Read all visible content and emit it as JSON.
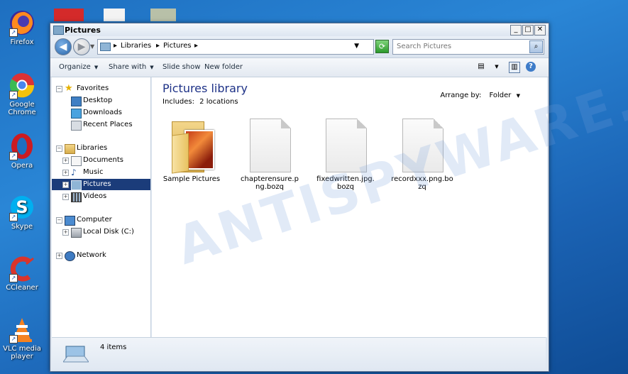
{
  "desktop": {
    "icons": [
      {
        "label": "Firefox",
        "icon": "firefox-icon"
      },
      {
        "label": "Google Chrome",
        "icon": "chrome-icon"
      },
      {
        "label": "Opera",
        "icon": "opera-icon"
      },
      {
        "label": "Skype",
        "icon": "skype-icon"
      },
      {
        "label": "CCleaner",
        "icon": "ccleaner-icon"
      },
      {
        "label": "VLC media player",
        "icon": "vlc-icon"
      }
    ]
  },
  "window": {
    "title": "Pictures",
    "controls": {
      "minimize": "_",
      "maximize": "□",
      "close": "✕"
    }
  },
  "address": {
    "crumbs": [
      "Libraries",
      "Pictures"
    ],
    "separator": "▸"
  },
  "search": {
    "placeholder": "Search Pictures"
  },
  "toolbar": {
    "organize": "Organize",
    "share_with": "Share with",
    "slide_show": "Slide show",
    "new_folder": "New folder"
  },
  "nav": {
    "favorites": "Favorites",
    "desktop": "Desktop",
    "downloads": "Downloads",
    "recent_places": "Recent Places",
    "libraries": "Libraries",
    "documents": "Documents",
    "music": "Music",
    "pictures": "Pictures",
    "videos": "Videos",
    "computer": "Computer",
    "local_disk": "Local Disk (C:)",
    "network": "Network"
  },
  "library": {
    "title": "Pictures library",
    "includes_label": "Includes:",
    "includes_value": "2 locations",
    "arrange_label": "Arrange by:",
    "arrange_value": "Folder"
  },
  "files": [
    {
      "name": "Sample Pictures",
      "type": "folder"
    },
    {
      "name": "chapterensure.png.bozq",
      "type": "file"
    },
    {
      "name": "fixedwritten.jpg.bozq",
      "type": "file"
    },
    {
      "name": "recordxxx.png.bozq",
      "type": "file"
    }
  ],
  "details": {
    "item_count": "4 items"
  },
  "watermark": "ANTISPYWARE.COM",
  "colors": {
    "selection": "#1b3c7a",
    "title_blue": "#1e3287",
    "desktop": "#1e6fc0"
  }
}
